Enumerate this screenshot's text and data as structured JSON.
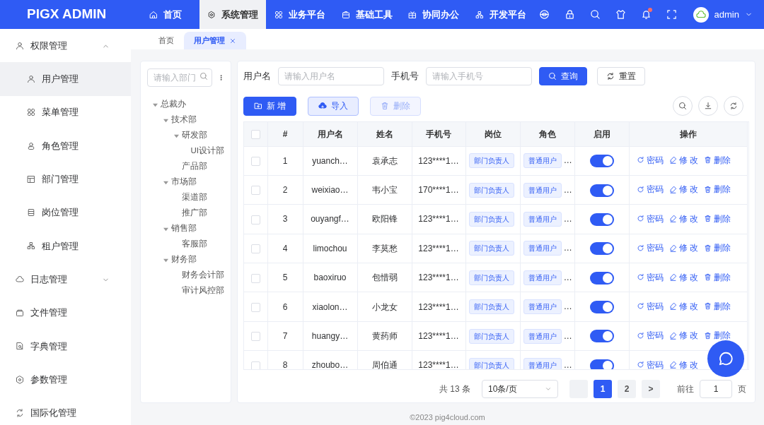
{
  "brand": "PIGX ADMIN",
  "top_nav": [
    {
      "label": "首页",
      "selected": false
    },
    {
      "label": "系统管理",
      "selected": true
    },
    {
      "label": "业务平台",
      "selected": false
    },
    {
      "label": "基础工具",
      "selected": false
    },
    {
      "label": "协同办公",
      "selected": false
    },
    {
      "label": "开发平台",
      "selected": false
    }
  ],
  "user": {
    "name": "admin",
    "notification": true
  },
  "sidebar": {
    "items": [
      {
        "label": "权限管理",
        "expanded": true,
        "children": [
          {
            "label": "用户管理",
            "selected": true
          },
          {
            "label": "菜单管理",
            "selected": false
          },
          {
            "label": "角色管理",
            "selected": false
          },
          {
            "label": "部门管理",
            "selected": false
          },
          {
            "label": "岗位管理",
            "selected": false
          },
          {
            "label": "租户管理",
            "selected": false
          }
        ]
      },
      {
        "label": "日志管理",
        "expanded": false
      },
      {
        "label": "文件管理"
      },
      {
        "label": "字典管理"
      },
      {
        "label": "参数管理"
      },
      {
        "label": "国际化管理"
      }
    ]
  },
  "page_tabs": [
    {
      "label": "首页",
      "selected": false,
      "closable": false
    },
    {
      "label": "用户管理",
      "selected": true,
      "closable": true
    }
  ],
  "dept_tree": {
    "search": {
      "placeholder": "请输入部门"
    },
    "nodes": [
      {
        "label": "总裁办",
        "expanded": true,
        "children": [
          {
            "label": "技术部",
            "expanded": true,
            "children": [
              {
                "label": "研发部",
                "expanded": true,
                "children": [
                  {
                    "label": "UI设计部"
                  }
                ]
              },
              {
                "label": "产品部"
              }
            ]
          },
          {
            "label": "市场部",
            "expanded": true,
            "children": [
              {
                "label": "渠道部"
              },
              {
                "label": "推广部"
              }
            ]
          },
          {
            "label": "销售部",
            "expanded": true,
            "children": [
              {
                "label": "客服部"
              }
            ]
          },
          {
            "label": "财务部",
            "expanded": true,
            "children": [
              {
                "label": "财务会计部"
              },
              {
                "label": "审计风控部"
              }
            ]
          }
        ]
      }
    ]
  },
  "filters": [
    {
      "label": "用户名",
      "placeholder": "请输入用户名"
    },
    {
      "label": "手机号",
      "placeholder": "请输入手机号"
    }
  ],
  "filter_buttons": [
    {
      "label": "查询",
      "kind": "primary"
    },
    {
      "label": "重置",
      "kind": "default"
    }
  ],
  "toolbar_buttons": [
    {
      "label": "新 增",
      "kind": "primary",
      "disabled": false
    },
    {
      "label": "导入",
      "kind": "light",
      "disabled": false
    },
    {
      "label": "删除",
      "kind": "light",
      "disabled": true
    }
  ],
  "table": {
    "header_checked": false,
    "columns": [
      "#",
      "用户名",
      "姓名",
      "手机号",
      "岗位",
      "角色",
      "启用",
      "操作"
    ],
    "rows": [
      {
        "index": "1",
        "username": "yuanch…",
        "name": "袁承志",
        "phone": "123****1…",
        "post": "部门负责人",
        "role": "普通用户",
        "role_more": "…",
        "enabled": true,
        "checked": false,
        "actions": [
          "密码",
          "修 改",
          "删除"
        ]
      },
      {
        "index": "2",
        "username": "weixiao…",
        "name": "韦小宝",
        "phone": "170****1…",
        "post": "部门负责人",
        "role": "普通用户",
        "role_more": "…",
        "enabled": true,
        "checked": false,
        "actions": [
          "密码",
          "修 改",
          "删除"
        ]
      },
      {
        "index": "3",
        "username": "ouyangf…",
        "name": "欧阳锋",
        "phone": "123****1…",
        "post": "部门负责人",
        "role": "普通用户",
        "role_more": "…",
        "enabled": true,
        "checked": false,
        "actions": [
          "密码",
          "修 改",
          "删除"
        ]
      },
      {
        "index": "4",
        "username": "limochou",
        "name": "李莫愁",
        "phone": "123****1…",
        "post": "部门负责人",
        "role": "普通用户",
        "role_more": "…",
        "enabled": true,
        "checked": false,
        "actions": [
          "密码",
          "修 改",
          "删除"
        ]
      },
      {
        "index": "5",
        "username": "baoxiruo",
        "name": "包惜弱",
        "phone": "123****1…",
        "post": "部门负责人",
        "role": "普通用户",
        "role_more": "…",
        "enabled": true,
        "checked": false,
        "actions": [
          "密码",
          "修 改",
          "删除"
        ]
      },
      {
        "index": "6",
        "username": "xiaolon…",
        "name": "小龙女",
        "phone": "123****1…",
        "post": "部门负责人",
        "role": "普通用户",
        "role_more": "…",
        "enabled": true,
        "checked": false,
        "actions": [
          "密码",
          "修 改",
          "删除"
        ]
      },
      {
        "index": "7",
        "username": "huangy…",
        "name": "黄药师",
        "phone": "123****1…",
        "post": "部门负责人",
        "role": "普通用户",
        "role_more": "…",
        "enabled": true,
        "checked": false,
        "actions": [
          "密码",
          "修 改",
          "删除"
        ]
      },
      {
        "index": "8",
        "username": "zhoubo…",
        "name": "周伯通",
        "phone": "123****1…",
        "post": "部门负责人",
        "role": "普通用户",
        "role_more": "…",
        "enabled": true,
        "checked": false,
        "actions": [
          "密码",
          "修 改"
        ]
      }
    ]
  },
  "pagination": {
    "total": "共 13 条",
    "page_size": "10条/页",
    "pages": [
      {
        "label": "1",
        "selected": true
      },
      {
        "label": "2",
        "selected": false
      }
    ],
    "next": ">",
    "goto_label": "前往",
    "goto_value": "1",
    "goto_suffix": "页"
  },
  "footer": "©2023 pig4cloud.com"
}
